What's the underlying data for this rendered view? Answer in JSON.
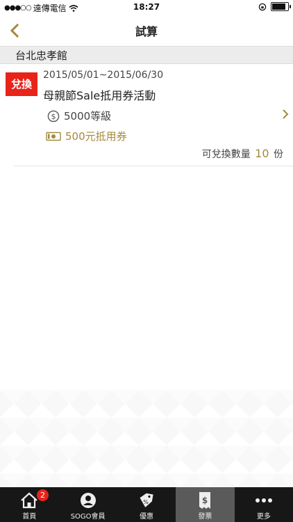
{
  "status_bar": {
    "carrier": "遠傳電信",
    "time": "18:27"
  },
  "nav": {
    "title": "試算"
  },
  "section": {
    "title": "台北忠孝館"
  },
  "promo": {
    "badge": "兌換",
    "date_range": "2015/05/01~2015/06/30",
    "title": "母親節Sale抵用券活動",
    "level": "5000等級",
    "voucher": "500元抵用券",
    "quantity_prefix": "可兌換數量",
    "quantity_value": "10",
    "quantity_suffix": "份"
  },
  "tabs": [
    {
      "label": "首頁",
      "badge": "2"
    },
    {
      "label": "SOGO會員"
    },
    {
      "label": "優惠"
    },
    {
      "label": "發票"
    },
    {
      "label": "更多"
    }
  ],
  "colors": {
    "accent": "#a38a3c",
    "badge": "#e8231a",
    "tabbar": "#171717",
    "tab_active": "#5a5a5a"
  }
}
